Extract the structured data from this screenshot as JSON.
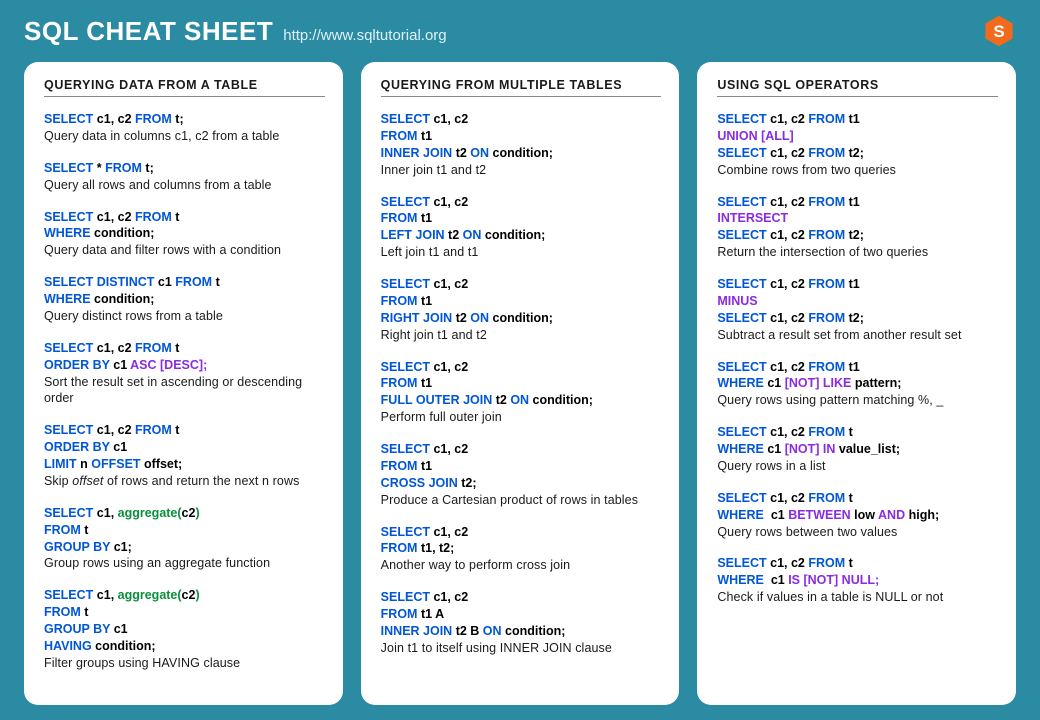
{
  "header": {
    "title": "SQL CHEAT SHEET",
    "url": "http://www.sqltutorial.org"
  },
  "columns": [
    {
      "heading": "QUERYING DATA FROM A TABLE",
      "items": [
        {
          "code": "<span class='kw'>SELECT</span> c1, c2 <span class='kw'>FROM</span> t;",
          "desc": "Query data in columns c1, c2 from a table"
        },
        {
          "code": "<span class='kw'>SELECT</span> * <span class='kw'>FROM</span> t;",
          "desc": "Query all rows and columns from a table"
        },
        {
          "code": "<span class='kw'>SELECT</span> c1, c2 <span class='kw'>FROM</span> t<br><span class='kw'>WHERE</span> condition;",
          "desc": "Query data and filter rows with a condition"
        },
        {
          "code": "<span class='kw'>SELECT DISTINCT</span> c1 <span class='kw'>FROM</span> t<br><span class='kw'>WHERE</span> condition;",
          "desc": "Query distinct rows from a table"
        },
        {
          "code": "<span class='kw'>SELECT</span> c1, c2 <span class='kw'>FROM</span> t<br><span class='kw'>ORDER BY</span> c1 <span class='opt'>ASC [DESC];</span>",
          "desc": "Sort the result set in ascending or descending order"
        },
        {
          "code": "<span class='kw'>SELECT</span> c1, c2 <span class='kw'>FROM</span> t<br><span class='kw'>ORDER BY</span> c1<br><span class='kw'>LIMIT</span> n <span class='kw'>OFFSET</span> offset;",
          "desc": "Skip <em>offset</em> of rows and return the next n rows"
        },
        {
          "code": "<span class='kw'>SELECT</span> c1, <span class='fn'>aggregate(</span>c2<span class='fn'>)</span><br><span class='kw'>FROM</span> t<br><span class='kw'>GROUP BY</span> c1;",
          "desc": "Group rows using an aggregate function"
        },
        {
          "code": "<span class='kw'>SELECT</span> c1, <span class='fn'>aggregate(</span>c2<span class='fn'>)</span><br><span class='kw'>FROM</span> t<br><span class='kw'>GROUP BY</span> c1<br><span class='kw'>HAVING</span> condition;",
          "desc": "Filter groups using HAVING clause"
        }
      ]
    },
    {
      "heading": "QUERYING FROM MULTIPLE TABLES",
      "items": [
        {
          "code": "<span class='kw'>SELECT</span> c1, c2<br><span class='kw'>FROM</span> t1<br><span class='kw'>INNER JOIN</span> t2 <span class='kw'>ON</span> condition;",
          "desc": "Inner join t1 and t2"
        },
        {
          "code": "<span class='kw'>SELECT</span> c1, c2<br><span class='kw'>FROM</span> t1<br><span class='kw'>LEFT JOIN</span> t2 <span class='kw'>ON</span> condition;",
          "desc": "Left join t1 and t1"
        },
        {
          "code": "<span class='kw'>SELECT</span> c1, c2<br><span class='kw'>FROM</span> t1<br><span class='kw'>RIGHT JOIN</span> t2 <span class='kw'>ON</span> condition;",
          "desc": "Right join t1 and t2"
        },
        {
          "code": "<span class='kw'>SELECT</span> c1, c2<br><span class='kw'>FROM</span> t1<br><span class='kw'>FULL OUTER JOIN</span> t2 <span class='kw'>ON</span> condition;",
          "desc": "Perform full outer join"
        },
        {
          "code": "<span class='kw'>SELECT</span> c1, c2<br><span class='kw'>FROM</span> t1<br><span class='kw'>CROSS JOIN</span> t2;",
          "desc": "Produce a Cartesian product of rows in tables"
        },
        {
          "code": "<span class='kw'>SELECT</span> c1, c2<br><span class='kw'>FROM</span> t1, t2;",
          "desc": "Another way to perform cross join"
        },
        {
          "code": "<span class='kw'>SELECT</span> c1, c2<br><span class='kw'>FROM</span> t1 A<br><span class='kw'>INNER JOIN</span> t2 B <span class='kw'>ON</span> condition;",
          "desc": "Join t1 to itself using INNER JOIN clause"
        }
      ]
    },
    {
      "heading": "USING SQL OPERATORS",
      "items": [
        {
          "code": "<span class='kw'>SELECT</span> c1, c2 <span class='kw'>FROM</span> t1<br><span class='opt'>UNION [ALL]</span><br><span class='kw'>SELECT</span> c1, c2 <span class='kw'>FROM</span> t2;",
          "desc": "Combine rows from two queries"
        },
        {
          "code": "<span class='kw'>SELECT</span> c1, c2 <span class='kw'>FROM</span> t1<br><span class='opt'>INTERSECT</span><br><span class='kw'>SELECT</span> c1, c2 <span class='kw'>FROM</span> t2;",
          "desc": "Return the intersection of two queries"
        },
        {
          "code": "<span class='kw'>SELECT</span> c1, c2 <span class='kw'>FROM</span> t1<br><span class='opt'>MINUS</span><br><span class='kw'>SELECT</span> c1, c2 <span class='kw'>FROM</span> t2;",
          "desc": "Subtract a result set from another result set"
        },
        {
          "code": "<span class='kw'>SELECT</span> c1, c2 <span class='kw'>FROM</span> t1<br><span class='kw'>WHERE</span> c1 <span class='opt'>[NOT] LIKE</span> pattern;",
          "desc": "Query rows using pattern matching %, _"
        },
        {
          "code": "<span class='kw'>SELECT</span> c1, c2 <span class='kw'>FROM</span> t<br><span class='kw'>WHERE</span> c1 <span class='opt'>[NOT] IN</span> value_list;",
          "desc": "Query rows in a list"
        },
        {
          "code": "<span class='kw'>SELECT</span> c1, c2 <span class='kw'>FROM</span> t<br><span class='kw'>WHERE</span>&nbsp; c1 <span class='opt'>BETWEEN</span> low <span class='opt'>AND</span> high;",
          "desc": "Query rows between two values"
        },
        {
          "code": "<span class='kw'>SELECT</span> c1, c2 <span class='kw'>FROM</span> t<br><span class='kw'>WHERE</span>&nbsp; c1 <span class='opt'>IS [NOT] NULL;</span>",
          "desc": "Check if values in a table is NULL or not"
        }
      ]
    }
  ]
}
